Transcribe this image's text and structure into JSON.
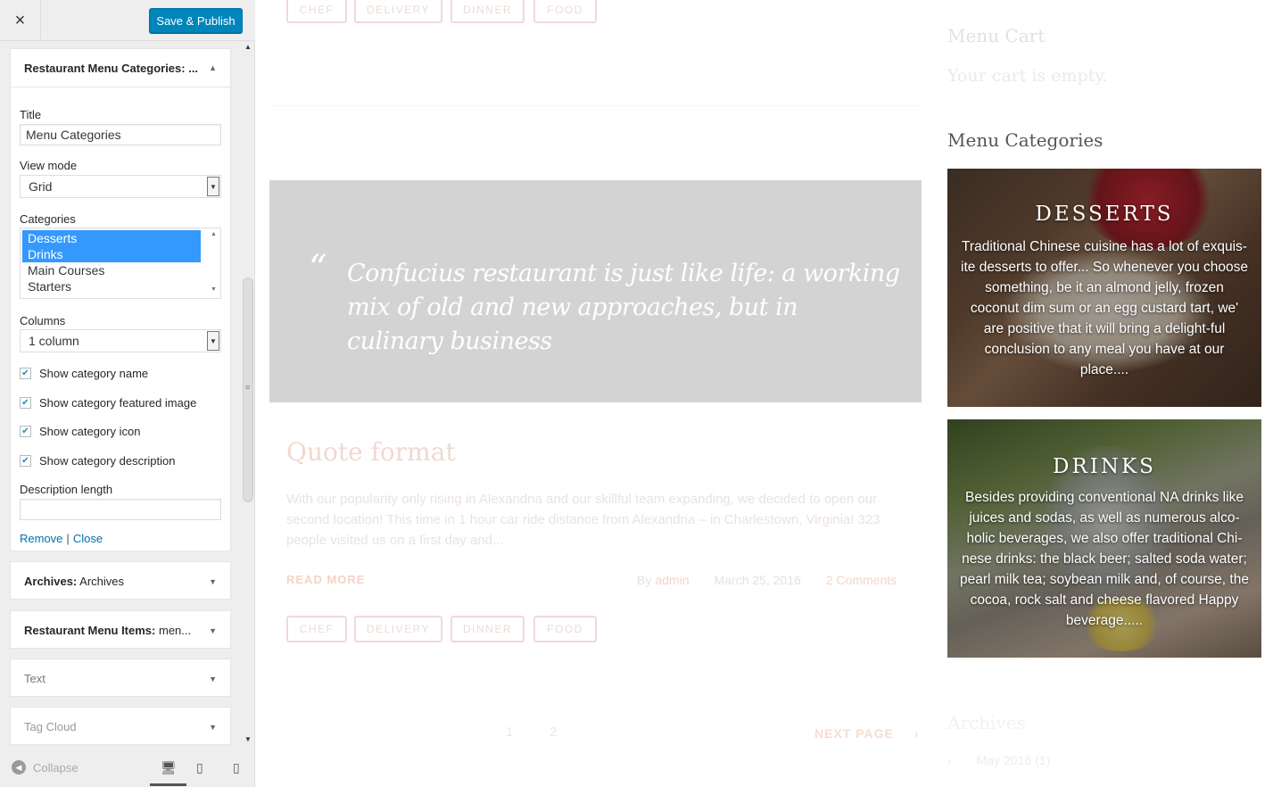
{
  "customizer": {
    "save_label": "Save & Publish",
    "close_icon": "×",
    "collapse_label": "Collapse",
    "widgets": {
      "restaurant_menu_categories": {
        "header": "Restaurant Menu Categories: ...",
        "title_label": "Title",
        "title_value": "Menu Categories",
        "view_mode_label": "View mode",
        "view_mode_value": "Grid",
        "categories_label": "Categories",
        "categories_options": [
          "Desserts",
          "Drinks",
          "Main Courses",
          "Starters"
        ],
        "categories_selected": [
          "Desserts",
          "Drinks"
        ],
        "columns_label": "Columns",
        "columns_value": "1 column",
        "checkboxes": [
          {
            "label": "Show category name",
            "checked": true
          },
          {
            "label": "Show category featured image",
            "checked": true
          },
          {
            "label": "Show category icon",
            "checked": true
          },
          {
            "label": "Show category description",
            "checked": true
          }
        ],
        "description_length_label": "Description length",
        "description_length_value": "",
        "remove_label": "Remove",
        "separator": "|",
        "close_label": "Close"
      },
      "archives": {
        "bold": "Archives:",
        "rest": " Archives"
      },
      "restaurant_menu_items": {
        "bold": "Restaurant Menu Items:",
        "rest": " men..."
      },
      "text": {
        "label": "Text"
      },
      "tag_cloud": {
        "label": "Tag Cloud"
      }
    }
  },
  "preview": {
    "top_tags": [
      "CHEF",
      "DELIVERY",
      "DINNER",
      "FOOD"
    ],
    "quote_mark": "“",
    "quote_text": "Confucius restaurant is just like life: a working mix of old and new approaches, but in culinary business",
    "post_title": "Quote format",
    "post_excerpt": "With our popularity only rising in Alexandria and our skillful team expanding, we decided to open our second location! This time in 1 hour car ride distance from Alexandria – in Charlestown, Virginia! 323 people visited us on a first day and...",
    "read_more": "READ MORE",
    "meta": {
      "by": "By",
      "author": "admin",
      "date": "March 25, 2016",
      "comments": "2 Comments"
    },
    "bottom_tags": [
      "CHEF",
      "DELIVERY",
      "DINNER",
      "FOOD"
    ],
    "pagination": [
      "1",
      "2"
    ],
    "next_page": "NEXT PAGE",
    "next_arrow": "›",
    "sidebar": {
      "menu_cart_title": "Menu Cart",
      "cart_empty": "Your cart is empty.",
      "menu_categories_title": "Menu Categories",
      "categories": [
        {
          "name": "DESSERTS",
          "description": "Traditional Chinese cuisine has a lot of exquis-ite desserts to offer... So whenever you choose something, be it an almond jelly, frozen coconut dim sum or an egg custard tart, we' are positive that it will bring a delight-ful conclusion to any meal you have at our place...."
        },
        {
          "name": "DRINKS",
          "description": "Besides providing conventional NA drinks like juices and sodas, as well as numerous alco-holic beverages, we also offer traditional Chi-nese drinks: the black beer; salted soda water; pearl milk tea; soybean milk and, of course, the cocoa, rock salt and cheese flavored Happy beverage....."
        }
      ],
      "archives_title": "Archives",
      "archive_item": "May 2016 (1)"
    }
  }
}
